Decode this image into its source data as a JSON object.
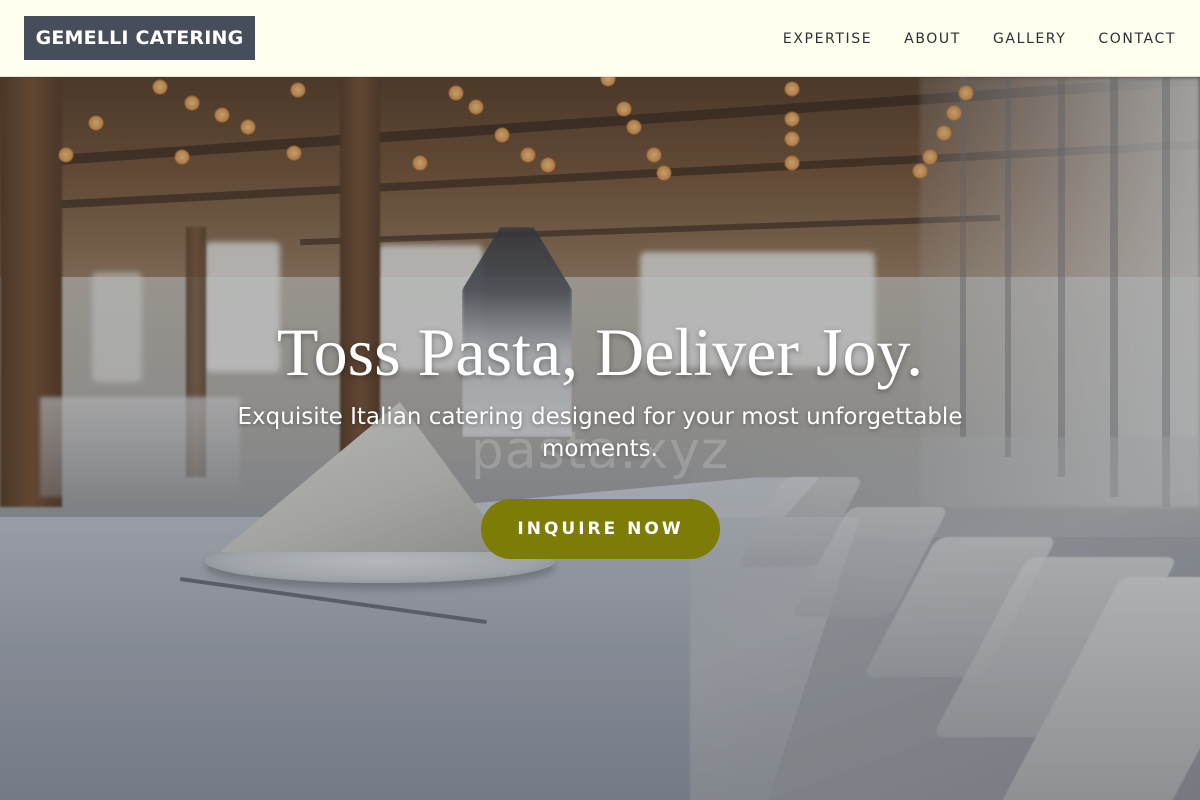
{
  "header": {
    "logo_text": "GEMELLI CATERING",
    "nav": [
      {
        "label": "EXPERTISE"
      },
      {
        "label": "ABOUT"
      },
      {
        "label": "GALLERY"
      },
      {
        "label": "CONTACT"
      }
    ]
  },
  "hero": {
    "title": "Toss Pasta, Deliver Joy.",
    "subtitle": "Exquisite Italian catering designed for your most unforgettable moments.",
    "cta_label": "INQUIRE NOW",
    "watermark": "pasta.xyz"
  },
  "colors": {
    "header_bg": "#fffff0",
    "logo_bg": "#474e5b",
    "cta_bg": "#7c7c06",
    "nav_text": "#2b2f36"
  }
}
